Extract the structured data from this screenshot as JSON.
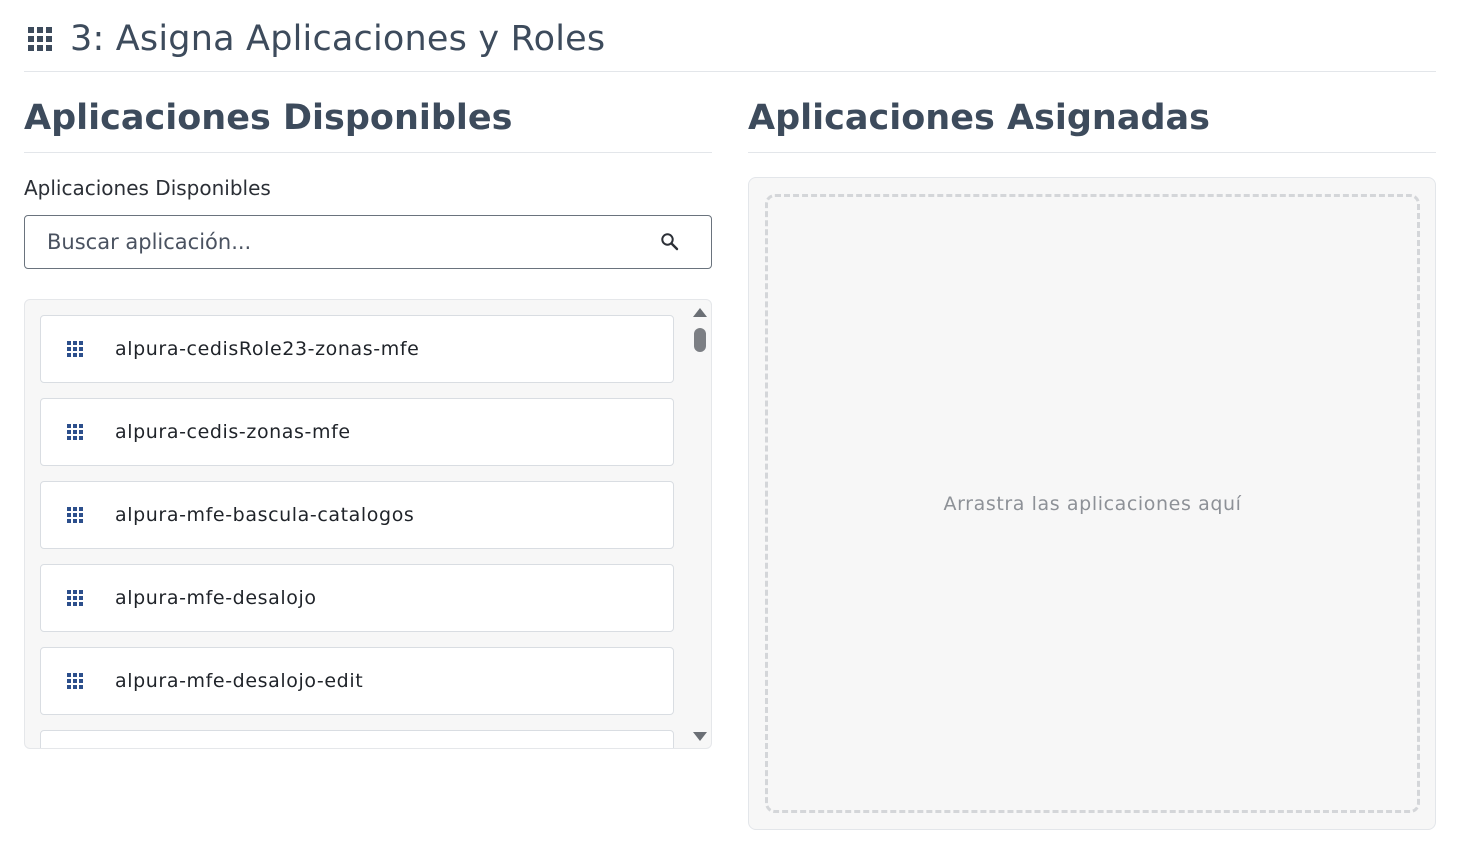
{
  "step": {
    "title": "3: Asigna Aplicaciones y Roles",
    "icon": "apps-grid-icon"
  },
  "available": {
    "heading": "Aplicaciones Disponibles",
    "field_label": "Aplicaciones Disponibles",
    "search_placeholder": "Buscar aplicación...",
    "search_icon": "search-icon",
    "items": [
      {
        "label": "alpura-cedisRole23-zonas-mfe"
      },
      {
        "label": "alpura-cedis-zonas-mfe"
      },
      {
        "label": "alpura-mfe-bascula-catalogos"
      },
      {
        "label": "alpura-mfe-desalojo"
      },
      {
        "label": "alpura-mfe-desalojo-edit"
      },
      {
        "label": ""
      }
    ]
  },
  "assigned": {
    "heading": "Aplicaciones Asignadas",
    "drop_hint": "Arrastra las aplicaciones aquí"
  },
  "colors": {
    "text_dark": "#3d4b5c",
    "item_icon": "#2c4f8c",
    "panel_bg": "#f7f7f7",
    "border": "#e3e6ea"
  }
}
